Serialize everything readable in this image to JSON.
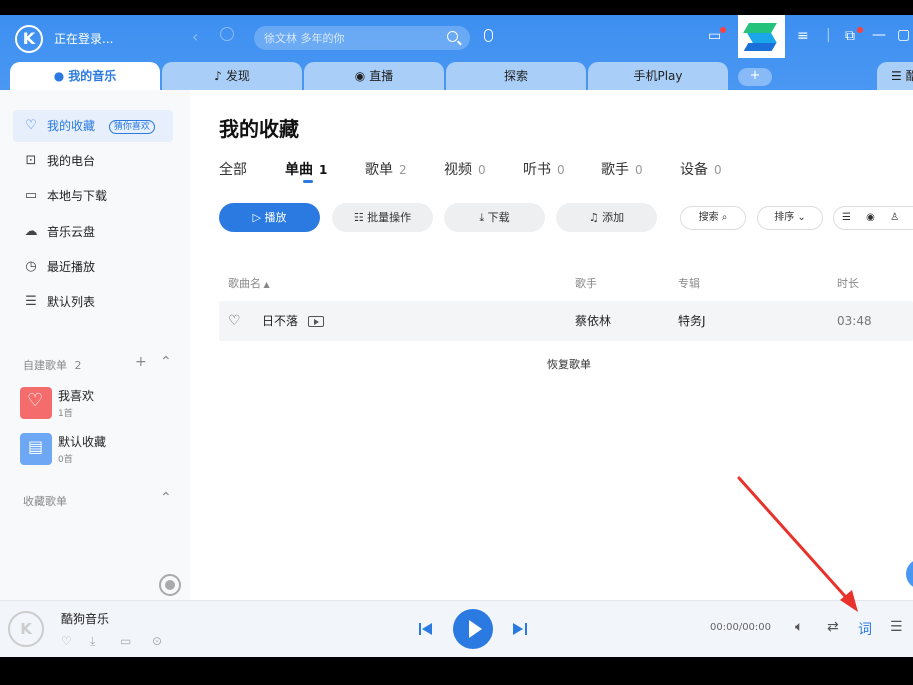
{
  "titlebar": {
    "logo_letter": "K",
    "login_status": "正在登录...",
    "search_placeholder": "徐文林 多年的你"
  },
  "tabs": [
    {
      "label": "我的音乐",
      "icon": "user-icon"
    },
    {
      "label": "发现",
      "icon": "tiktok-note-icon"
    },
    {
      "label": "直播",
      "icon": "live-icon"
    },
    {
      "label": "探索",
      "icon": ""
    },
    {
      "label": "手机Play",
      "icon": ""
    },
    {
      "label": "酷",
      "icon": "menu-icon"
    }
  ],
  "sidebar": {
    "items": [
      {
        "label": "我的收藏",
        "icon": "heart-icon",
        "badge": "猜你喜欢",
        "active": true
      },
      {
        "label": "我的电台",
        "icon": "radio-icon"
      },
      {
        "label": "本地与下载",
        "icon": "monitor-icon"
      },
      {
        "label": "音乐云盘",
        "icon": "cloud-icon"
      },
      {
        "label": "最近播放",
        "icon": "clock-icon"
      },
      {
        "label": "默认列表",
        "icon": "list-icon"
      }
    ],
    "custom_section": {
      "label": "自建歌单",
      "count": "2"
    },
    "playlists": [
      {
        "name": "我喜欢",
        "count": "1首",
        "color": "#f56c6c"
      },
      {
        "name": "默认收藏",
        "count": "0首",
        "color": "#6ea8f5"
      }
    ],
    "collected_section": {
      "label": "收藏歌单"
    }
  },
  "main": {
    "title": "我的收藏",
    "subtabs": [
      {
        "label": "全部",
        "count": ""
      },
      {
        "label": "单曲",
        "count": "1"
      },
      {
        "label": "歌单",
        "count": "2"
      },
      {
        "label": "视频",
        "count": "0"
      },
      {
        "label": "听书",
        "count": "0"
      },
      {
        "label": "歌手",
        "count": "0"
      },
      {
        "label": "设备",
        "count": "0"
      }
    ],
    "actions": {
      "play": "播放",
      "batch": "批量操作",
      "download": "下载",
      "add": "添加"
    },
    "tools": {
      "search": "搜索",
      "sort": "排序"
    },
    "columns": {
      "name": "歌曲名",
      "artist": "歌手",
      "album": "专辑",
      "duration": "时长"
    },
    "songs": [
      {
        "name": "日不落",
        "artist": "蔡依林",
        "album": "特务J",
        "duration": "03:48"
      }
    ],
    "restore_label": "恢复歌单"
  },
  "player": {
    "logo_letter": "K",
    "title": "酷狗音乐",
    "time": "00:00/00:00",
    "lyric_label": "词"
  },
  "colors": {
    "accent": "#2a7ae2",
    "titlebar": "#4a97f3",
    "annotation_arrow": "#e8322b"
  }
}
